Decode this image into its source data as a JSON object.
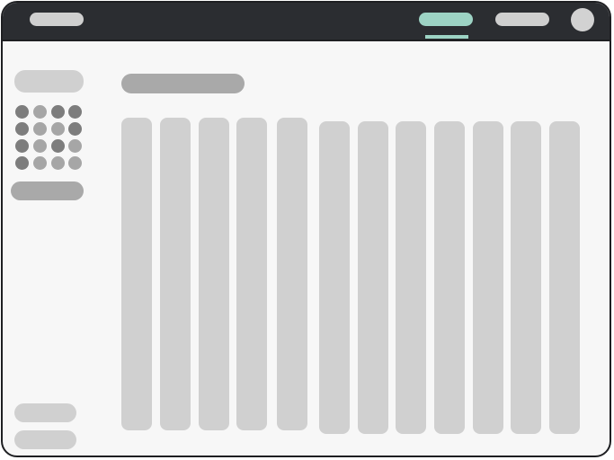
{
  "colors": {
    "topbar": "#2b2d31",
    "accent": "#9dd3c4",
    "placeholder_light": "#d0d0d0",
    "placeholder_mid": "#a9a9a9",
    "placeholder_dark": "#7d7d7d",
    "background": "#f7f7f7"
  },
  "header": {
    "logo": "",
    "nav": [
      {
        "label": "",
        "active": true
      },
      {
        "label": "",
        "active": false
      }
    ],
    "avatar_icon": "user-avatar-icon"
  },
  "sidebar": {
    "top_item": "",
    "icon_grid_shades": [
      [
        "dark",
        "light",
        "dark",
        "dark"
      ],
      [
        "dark",
        "light",
        "light",
        "dark"
      ],
      [
        "dark",
        "light",
        "dark",
        "light"
      ],
      [
        "dark",
        "light",
        "light",
        "light"
      ]
    ],
    "selected_item": "",
    "bottom_items": [
      "",
      ""
    ]
  },
  "main": {
    "heading": "",
    "columns": [
      "",
      "",
      "",
      "",
      "",
      "",
      "",
      "",
      "",
      "",
      "",
      ""
    ]
  }
}
